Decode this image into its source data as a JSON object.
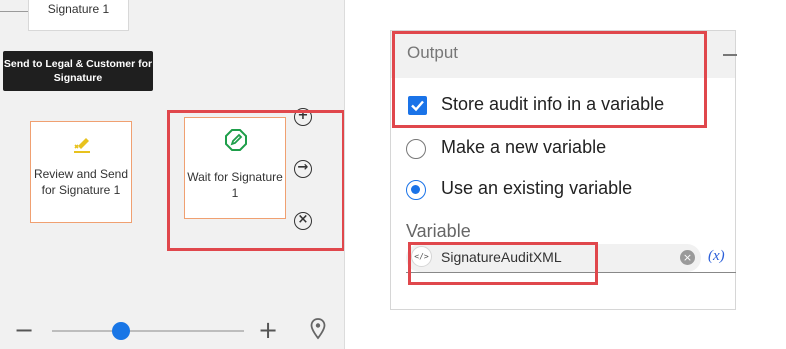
{
  "canvas": {
    "top_card_label": "Signature 1",
    "tooltip_text": "Send to Legal  & Customer for Signature",
    "review_card_label": "Review and Send for Signature 1",
    "wait_card_label": "Wait for Signature 1",
    "add_symbol": "+",
    "next_symbol": "→",
    "close_symbol": "×",
    "zoom_out_symbol": "−",
    "zoom_in_symbol": "+",
    "zoom_level": 0.32
  },
  "panel": {
    "section_title": "Output",
    "collapse_symbol": "−",
    "store_audit_label": "Store audit info in a variable",
    "store_audit_checked": true,
    "make_new_label": "Make a new variable",
    "use_existing_label": "Use an existing variable",
    "selected_option": "use_existing",
    "variable_label": "Variable",
    "variable_value": "SignatureAuditXML",
    "code_chip_text": "</>",
    "clear_symbol": "×",
    "expression_symbol": "(x)"
  },
  "colors": {
    "accent_blue": "#1a73e8",
    "card_border_orange": "#f0a071",
    "highlight_red": "#e0474c",
    "pen_green": "#1e9e4a",
    "pen_yellow": "#e8c21e"
  },
  "icons": [
    "pen-yellow-icon",
    "pen-green-icon",
    "add-icon",
    "arrow-right-icon",
    "close-icon",
    "location-pin-icon",
    "code-icon",
    "clear-icon",
    "expression-icon"
  ]
}
